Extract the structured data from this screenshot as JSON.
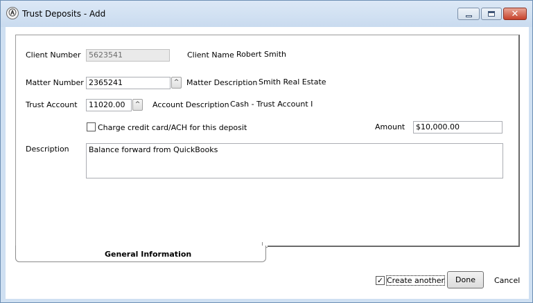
{
  "window": {
    "title": "Trust Deposits - Add",
    "app_icon": "Ⓐ",
    "controls": {
      "minimize_icon": "minimize-icon",
      "maximize_icon": "maximize-icon",
      "close_icon": "close-icon",
      "close_glyph": "✕"
    }
  },
  "form": {
    "client_number_label": "Client Number",
    "client_number_value": "5623541",
    "client_name_label": "Client Name",
    "client_name_value": "Robert Smith",
    "matter_number_label": "Matter Number",
    "matter_number_value": "2365241",
    "matter_description_label": "Matter Description",
    "matter_description_value": "Smith Real Estate",
    "trust_account_label": "Trust Account",
    "trust_account_value": "11020.00",
    "account_description_label": "Account Description",
    "account_description_value": "Cash - Trust Account I",
    "charge_card_label": "Charge credit card/ACH for this deposit",
    "charge_card_checked": false,
    "amount_label": "Amount",
    "amount_value": "$10,000.00",
    "description_label": "Description",
    "description_value": "Balance forward from QuickBooks",
    "lookup_glyph": "^"
  },
  "tabs": [
    {
      "label": "General Information",
      "active": true
    }
  ],
  "footer": {
    "create_another_label": "Create another",
    "create_another_checked": true,
    "check_glyph": "✓",
    "done_label": "Done",
    "cancel_label": "Cancel"
  },
  "colors": {
    "window_frame": "#cfe0f2",
    "close_button": "#c7412a",
    "readonly_field": "#eaeaea"
  }
}
